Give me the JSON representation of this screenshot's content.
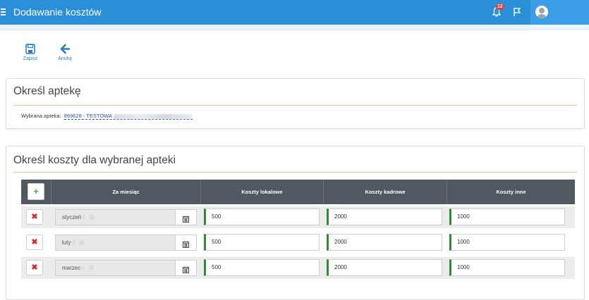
{
  "header": {
    "title": "Dodawanie kosztów",
    "notification_count": "12"
  },
  "toolbar": {
    "save_label": "Zapisz",
    "cancel_label": "Anuluj"
  },
  "pharmacy_panel": {
    "title": "Określ aptekę",
    "selected_label": "Wybrana apteka:",
    "selected_value": "899628 - TESTOWA"
  },
  "costs_panel": {
    "title": "Określ koszty dla wybranej apteki",
    "columns": {
      "month": "Za miesiąc",
      "local": "Koszty lokalowe",
      "staff": "Koszty kadrowe",
      "other": "Koszty inne"
    },
    "rows": [
      {
        "month": "styczeń",
        "local": "500",
        "staff": "2000",
        "other": "1000"
      },
      {
        "month": "luty",
        "local": "500",
        "staff": "2000",
        "other": "1000"
      },
      {
        "month": "marzec",
        "local": "500",
        "staff": "2000",
        "other": "1000"
      }
    ]
  },
  "colors": {
    "topbar": "#2a8fd6",
    "accent_rule": "#f0c78a",
    "table_header": "#505861",
    "input_marker": "#2e8b2e",
    "delete": "#d32f2f",
    "add": "#4caf50"
  },
  "icons": [
    "menu-icon",
    "bell-icon",
    "flag-icon",
    "user-avatar-icon",
    "save-icon",
    "arrow-left-icon",
    "plus-icon",
    "times-icon",
    "calendar-icon"
  ]
}
